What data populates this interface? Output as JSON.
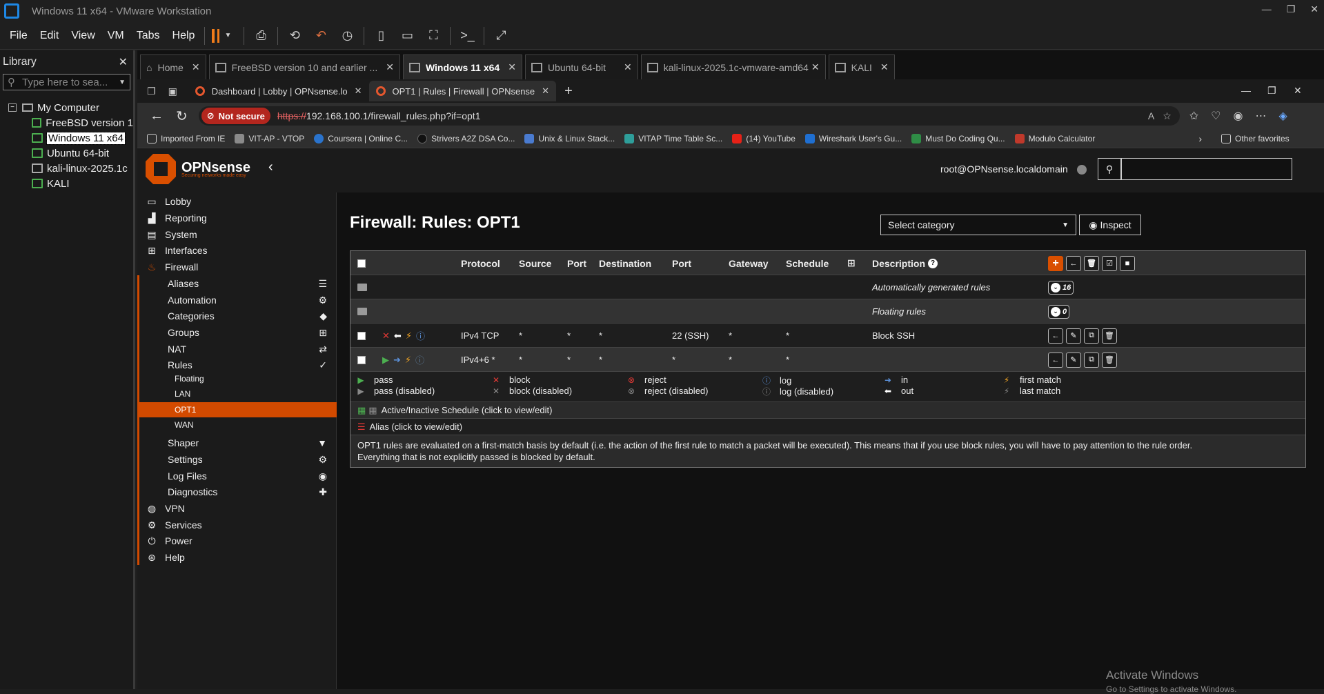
{
  "vmware": {
    "title": "Windows 11 x64 - VMware Workstation",
    "menu": [
      "File",
      "Edit",
      "View",
      "VM",
      "Tabs",
      "Help"
    ],
    "library": {
      "title": "Library",
      "search_placeholder": "Type here to sea...",
      "root": "My Computer",
      "items": [
        "FreeBSD version 1",
        "Windows 11 x64",
        "Ubuntu 64-bit",
        "kali-linux-2025.1c",
        "KALI"
      ]
    },
    "tabs": [
      {
        "label": "Home"
      },
      {
        "label": "FreeBSD version 10 and earlier ..."
      },
      {
        "label": "Windows 11 x64"
      },
      {
        "label": "Ubuntu 64-bit"
      },
      {
        "label": "kali-linux-2025.1c-vmware-amd64"
      },
      {
        "label": "KALI"
      }
    ]
  },
  "browser": {
    "tabs": [
      {
        "label": "Dashboard | Lobby | OPNsense.lo"
      },
      {
        "label": "OPT1 | Rules | Firewall | OPNsense"
      }
    ],
    "not_secure": "Not secure",
    "url_scheme": "https://",
    "url_rest": "192.168.100.1/firewall_rules.php?if=opt1",
    "bookmarks": [
      {
        "label": "Imported From IE",
        "color": "#e0c080"
      },
      {
        "label": "VIT-AP - VTOP",
        "color": "#8a8a8a"
      },
      {
        "label": "Coursera | Online C...",
        "color": "#2a73cc"
      },
      {
        "label": "Strivers A2Z DSA Co...",
        "color": "#111111"
      },
      {
        "label": "Unix & Linux Stack...",
        "color": "#4a7bd0"
      },
      {
        "label": "VITAP Time Table Sc...",
        "color": "#2e9e9a"
      },
      {
        "label": "(14) YouTube",
        "color": "#e62117"
      },
      {
        "label": "Wireshark User's Gu...",
        "color": "#1f6fd1"
      },
      {
        "label": "Must Do Coding Qu...",
        "color": "#2f8d46"
      },
      {
        "label": "Modulo Calculator",
        "color": "#c0392b"
      }
    ],
    "other_favorites": "Other favorites"
  },
  "opnsense": {
    "brand": "OPNsense",
    "tagline": "Securing networks made easy",
    "user": "root@OPNsense.localdomain",
    "sidebar": {
      "top": [
        "Lobby",
        "Reporting",
        "System",
        "Interfaces",
        "Firewall"
      ],
      "firewall_sub": [
        "Aliases",
        "Automation",
        "Categories",
        "Groups",
        "NAT",
        "Rules"
      ],
      "rules_sub": [
        "Floating",
        "LAN",
        "OPT1",
        "WAN"
      ],
      "firewall_sub2": [
        "Shaper",
        "Settings",
        "Log Files",
        "Diagnostics"
      ],
      "bottom": [
        "VPN",
        "Services",
        "Power",
        "Help"
      ]
    },
    "page_title": "Firewall: Rules: OPT1",
    "category_select": "Select category",
    "inspect": "Inspect",
    "columns": [
      "Protocol",
      "Source",
      "Port",
      "Destination",
      "Port",
      "Gateway",
      "Schedule",
      "Description"
    ],
    "auto_rules": {
      "label": "Automatically generated rules",
      "count": "16"
    },
    "floating_rules": {
      "label": "Floating rules",
      "count": "0"
    },
    "rules": [
      {
        "protocol": "IPv4 TCP",
        "source": "*",
        "sport": "*",
        "destination": "*",
        "dport": "22 (SSH)",
        "gateway": "*",
        "schedule": "*",
        "description": "Block SSH"
      },
      {
        "protocol": "IPv4+6 *",
        "source": "*",
        "sport": "*",
        "destination": "*",
        "dport": "*",
        "gateway": "*",
        "schedule": "*",
        "description": ""
      }
    ],
    "legend": {
      "pass": "pass",
      "pass_disabled": "pass (disabled)",
      "block": "block",
      "block_disabled": "block (disabled)",
      "reject": "reject",
      "reject_disabled": "reject (disabled)",
      "log": "log",
      "log_disabled": "log (disabled)",
      "in": "in",
      "out": "out",
      "first_match": "first match",
      "last_match": "last match"
    },
    "schedule_note": "Active/Inactive Schedule (click to view/edit)",
    "alias_note": "Alias (click to view/edit)",
    "footer_note_1": "OPT1 rules are evaluated on a first-match basis by default (i.e. the action of the first rule to match a packet will be executed). This means that if you use block rules, you will have to pay attention to the rule order.",
    "footer_note_2": "Everything that is not explicitly passed is blocked by default."
  },
  "watermark": {
    "line1": "Activate Windows",
    "line2": "Go to Settings to activate Windows."
  },
  "colors": {
    "accent": "#d94f00",
    "active_menu": "#d24a00"
  }
}
